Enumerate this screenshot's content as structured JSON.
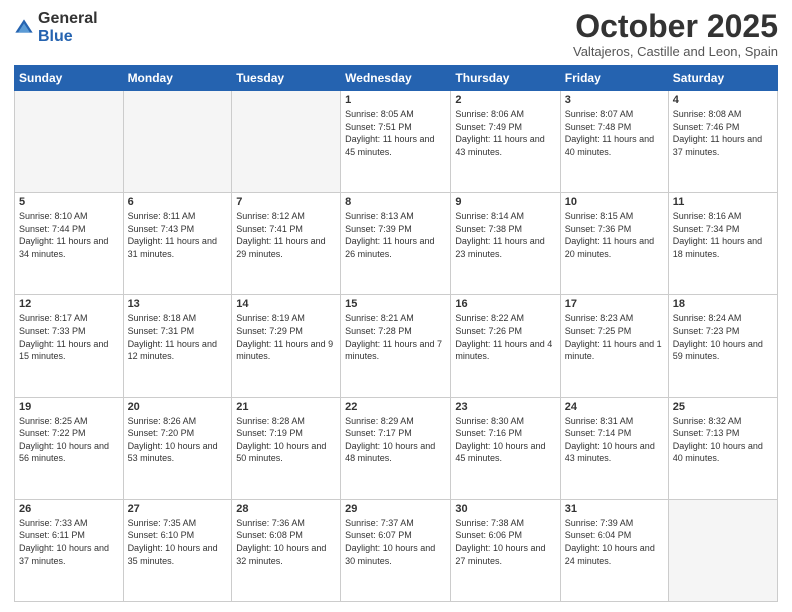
{
  "header": {
    "logo_general": "General",
    "logo_blue": "Blue",
    "month": "October 2025",
    "location": "Valtajeros, Castille and Leon, Spain"
  },
  "days_of_week": [
    "Sunday",
    "Monday",
    "Tuesday",
    "Wednesday",
    "Thursday",
    "Friday",
    "Saturday"
  ],
  "weeks": [
    [
      {
        "day": "",
        "info": ""
      },
      {
        "day": "",
        "info": ""
      },
      {
        "day": "",
        "info": ""
      },
      {
        "day": "1",
        "info": "Sunrise: 8:05 AM\nSunset: 7:51 PM\nDaylight: 11 hours and 45 minutes."
      },
      {
        "day": "2",
        "info": "Sunrise: 8:06 AM\nSunset: 7:49 PM\nDaylight: 11 hours and 43 minutes."
      },
      {
        "day": "3",
        "info": "Sunrise: 8:07 AM\nSunset: 7:48 PM\nDaylight: 11 hours and 40 minutes."
      },
      {
        "day": "4",
        "info": "Sunrise: 8:08 AM\nSunset: 7:46 PM\nDaylight: 11 hours and 37 minutes."
      }
    ],
    [
      {
        "day": "5",
        "info": "Sunrise: 8:10 AM\nSunset: 7:44 PM\nDaylight: 11 hours and 34 minutes."
      },
      {
        "day": "6",
        "info": "Sunrise: 8:11 AM\nSunset: 7:43 PM\nDaylight: 11 hours and 31 minutes."
      },
      {
        "day": "7",
        "info": "Sunrise: 8:12 AM\nSunset: 7:41 PM\nDaylight: 11 hours and 29 minutes."
      },
      {
        "day": "8",
        "info": "Sunrise: 8:13 AM\nSunset: 7:39 PM\nDaylight: 11 hours and 26 minutes."
      },
      {
        "day": "9",
        "info": "Sunrise: 8:14 AM\nSunset: 7:38 PM\nDaylight: 11 hours and 23 minutes."
      },
      {
        "day": "10",
        "info": "Sunrise: 8:15 AM\nSunset: 7:36 PM\nDaylight: 11 hours and 20 minutes."
      },
      {
        "day": "11",
        "info": "Sunrise: 8:16 AM\nSunset: 7:34 PM\nDaylight: 11 hours and 18 minutes."
      }
    ],
    [
      {
        "day": "12",
        "info": "Sunrise: 8:17 AM\nSunset: 7:33 PM\nDaylight: 11 hours and 15 minutes."
      },
      {
        "day": "13",
        "info": "Sunrise: 8:18 AM\nSunset: 7:31 PM\nDaylight: 11 hours and 12 minutes."
      },
      {
        "day": "14",
        "info": "Sunrise: 8:19 AM\nSunset: 7:29 PM\nDaylight: 11 hours and 9 minutes."
      },
      {
        "day": "15",
        "info": "Sunrise: 8:21 AM\nSunset: 7:28 PM\nDaylight: 11 hours and 7 minutes."
      },
      {
        "day": "16",
        "info": "Sunrise: 8:22 AM\nSunset: 7:26 PM\nDaylight: 11 hours and 4 minutes."
      },
      {
        "day": "17",
        "info": "Sunrise: 8:23 AM\nSunset: 7:25 PM\nDaylight: 11 hours and 1 minute."
      },
      {
        "day": "18",
        "info": "Sunrise: 8:24 AM\nSunset: 7:23 PM\nDaylight: 10 hours and 59 minutes."
      }
    ],
    [
      {
        "day": "19",
        "info": "Sunrise: 8:25 AM\nSunset: 7:22 PM\nDaylight: 10 hours and 56 minutes."
      },
      {
        "day": "20",
        "info": "Sunrise: 8:26 AM\nSunset: 7:20 PM\nDaylight: 10 hours and 53 minutes."
      },
      {
        "day": "21",
        "info": "Sunrise: 8:28 AM\nSunset: 7:19 PM\nDaylight: 10 hours and 50 minutes."
      },
      {
        "day": "22",
        "info": "Sunrise: 8:29 AM\nSunset: 7:17 PM\nDaylight: 10 hours and 48 minutes."
      },
      {
        "day": "23",
        "info": "Sunrise: 8:30 AM\nSunset: 7:16 PM\nDaylight: 10 hours and 45 minutes."
      },
      {
        "day": "24",
        "info": "Sunrise: 8:31 AM\nSunset: 7:14 PM\nDaylight: 10 hours and 43 minutes."
      },
      {
        "day": "25",
        "info": "Sunrise: 8:32 AM\nSunset: 7:13 PM\nDaylight: 10 hours and 40 minutes."
      }
    ],
    [
      {
        "day": "26",
        "info": "Sunrise: 7:33 AM\nSunset: 6:11 PM\nDaylight: 10 hours and 37 minutes."
      },
      {
        "day": "27",
        "info": "Sunrise: 7:35 AM\nSunset: 6:10 PM\nDaylight: 10 hours and 35 minutes."
      },
      {
        "day": "28",
        "info": "Sunrise: 7:36 AM\nSunset: 6:08 PM\nDaylight: 10 hours and 32 minutes."
      },
      {
        "day": "29",
        "info": "Sunrise: 7:37 AM\nSunset: 6:07 PM\nDaylight: 10 hours and 30 minutes."
      },
      {
        "day": "30",
        "info": "Sunrise: 7:38 AM\nSunset: 6:06 PM\nDaylight: 10 hours and 27 minutes."
      },
      {
        "day": "31",
        "info": "Sunrise: 7:39 AM\nSunset: 6:04 PM\nDaylight: 10 hours and 24 minutes."
      },
      {
        "day": "",
        "info": ""
      }
    ]
  ]
}
